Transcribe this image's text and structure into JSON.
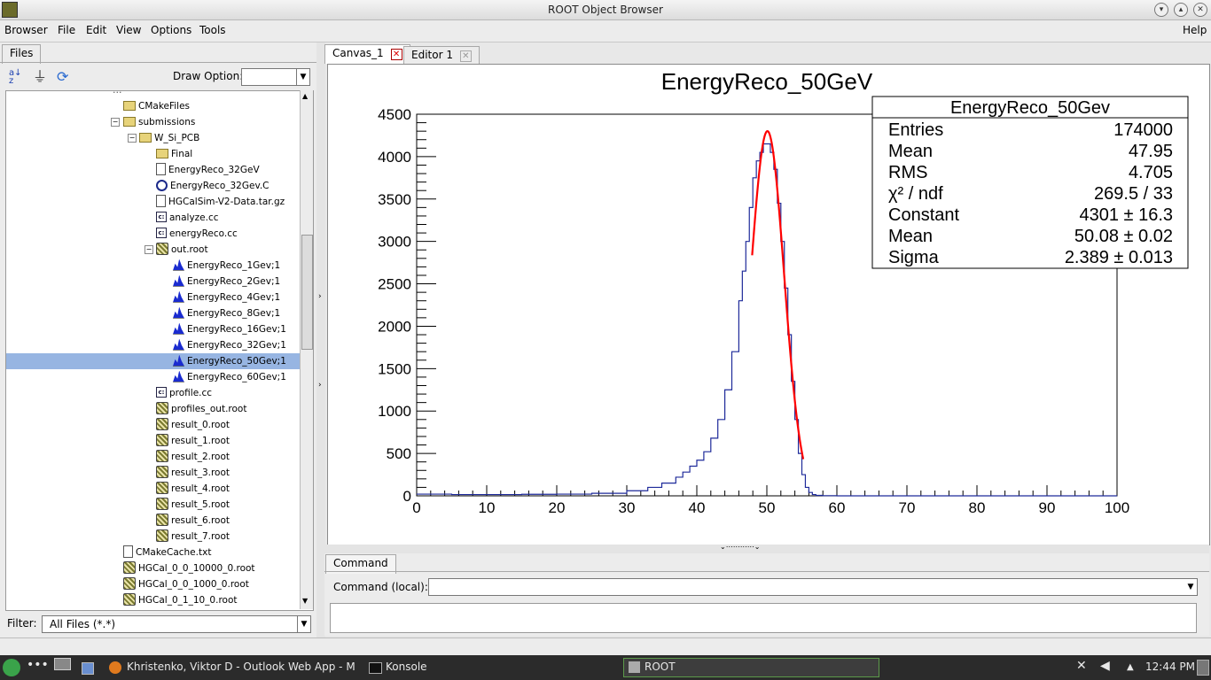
{
  "window": {
    "title": "ROOT Object Browser"
  },
  "menu": {
    "browser": "Browser",
    "file": "File",
    "edit": "Edit",
    "view": "View",
    "options": "Options",
    "tools": "Tools",
    "help": "Help"
  },
  "left": {
    "tab": "Files",
    "draw_option_label": "Draw Option:",
    "draw_option_value": "",
    "filter_label": "Filter:",
    "filter_value": "All Files (*.*)",
    "tree": [
      {
        "label": "CMakeFiles",
        "icon": "folder"
      },
      {
        "label": "submissions",
        "icon": "folder"
      },
      {
        "label": "W_Si_PCB",
        "icon": "folder"
      },
      {
        "label": "Final",
        "icon": "folder"
      },
      {
        "label": "EnergyReco_32GeV",
        "icon": "file"
      },
      {
        "label": "EnergyReco_32Gev.C",
        "icon": "cplus"
      },
      {
        "label": "HGCalSim-V2-Data.tar.gz",
        "icon": "file"
      },
      {
        "label": "analyze.cc",
        "icon": "cc"
      },
      {
        "label": "energyReco.cc",
        "icon": "cc"
      },
      {
        "label": "out.root",
        "icon": "root"
      },
      {
        "label": "EnergyReco_1Gev;1",
        "icon": "histo"
      },
      {
        "label": "EnergyReco_2Gev;1",
        "icon": "histo"
      },
      {
        "label": "EnergyReco_4Gev;1",
        "icon": "histo"
      },
      {
        "label": "EnergyReco_8Gev;1",
        "icon": "histo"
      },
      {
        "label": "EnergyReco_16Gev;1",
        "icon": "histo"
      },
      {
        "label": "EnergyReco_32Gev;1",
        "icon": "histo"
      },
      {
        "label": "EnergyReco_50Gev;1",
        "icon": "histo",
        "selected": true
      },
      {
        "label": "EnergyReco_60Gev;1",
        "icon": "histo"
      },
      {
        "label": "profile.cc",
        "icon": "cc"
      },
      {
        "label": "profiles_out.root",
        "icon": "root"
      },
      {
        "label": "result_0.root",
        "icon": "root"
      },
      {
        "label": "result_1.root",
        "icon": "root"
      },
      {
        "label": "result_2.root",
        "icon": "root"
      },
      {
        "label": "result_3.root",
        "icon": "root"
      },
      {
        "label": "result_4.root",
        "icon": "root"
      },
      {
        "label": "result_5.root",
        "icon": "root"
      },
      {
        "label": "result_6.root",
        "icon": "root"
      },
      {
        "label": "result_7.root",
        "icon": "root"
      },
      {
        "label": "CMakeCache.txt",
        "icon": "file"
      },
      {
        "label": "HGCal_0_0_10000_0.root",
        "icon": "root"
      },
      {
        "label": "HGCal_0_0_1000_0.root",
        "icon": "root"
      },
      {
        "label": "HGCal_0_1_10_0.root",
        "icon": "root"
      }
    ]
  },
  "tabs": {
    "canvas": "Canvas_1",
    "editor": "Editor 1"
  },
  "command": {
    "tab": "Command",
    "label": "Command (local):",
    "value": ""
  },
  "taskbar": {
    "outlook": "Khristenko, Viktor D - Outlook Web App - M",
    "konsole": "Konsole",
    "root": "ROOT",
    "clock": "12:44 PM"
  },
  "chart_data": {
    "type": "histogram",
    "title": "EnergyReco_50GeV",
    "xlim": [
      0,
      100
    ],
    "ylim": [
      0,
      4500
    ],
    "xticks": [
      0,
      10,
      20,
      30,
      40,
      50,
      60,
      70,
      80,
      90,
      100
    ],
    "yticks": [
      0,
      500,
      1000,
      1500,
      2000,
      2500,
      3000,
      3500,
      4000,
      4500
    ],
    "histogram": {
      "x": [
        0,
        5,
        10,
        15,
        20,
        25,
        30,
        33,
        35,
        37,
        38,
        39,
        40,
        41,
        42,
        43,
        44,
        45,
        46,
        46.5,
        47,
        47.5,
        48,
        48.5,
        49,
        49.5,
        50,
        50.5,
        51,
        51.5,
        52,
        52.5,
        53,
        53.5,
        54,
        54.5,
        55,
        55.5,
        56,
        56.5,
        57,
        58,
        60,
        100
      ],
      "y": [
        20,
        15,
        15,
        18,
        20,
        30,
        60,
        100,
        150,
        220,
        280,
        350,
        420,
        520,
        680,
        900,
        1250,
        1700,
        2300,
        2650,
        3000,
        3400,
        3750,
        3950,
        4050,
        4150,
        4150,
        4050,
        3850,
        3450,
        3000,
        2450,
        1900,
        1350,
        900,
        500,
        250,
        100,
        40,
        15,
        5,
        2,
        0,
        0
      ],
      "color": "#1e2a9a"
    },
    "fit": {
      "function": "gaus",
      "constant": 4301,
      "mean": 50.08,
      "sigma": 2.389,
      "range": [
        47.9,
        55.2
      ],
      "color": "#ff0000"
    },
    "stats": {
      "title": "EnergyReco_50Gev",
      "rows": [
        {
          "label": "Entries",
          "value": "174000"
        },
        {
          "label": "Mean",
          "value": "47.95"
        },
        {
          "label": "RMS",
          "value": "4.705"
        },
        {
          "label": "χ² / ndf",
          "value": "269.5 / 33"
        },
        {
          "label": "Constant",
          "value": "4301 ± 16.3"
        },
        {
          "label": "Mean",
          "value": "50.08 ± 0.02"
        },
        {
          "label": "Sigma",
          "value": "2.389 ± 0.013"
        }
      ]
    }
  }
}
